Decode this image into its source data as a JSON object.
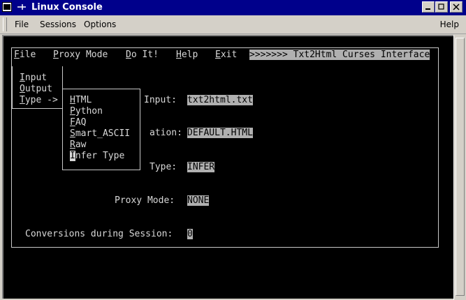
{
  "window": {
    "title": "Linux Console",
    "icons": {
      "app": "terminal-icon",
      "pin": "pin-icon",
      "minimize": "minimize-icon",
      "maximize": "maximize-icon",
      "close": "close-icon"
    }
  },
  "menubar": {
    "items": [
      "File",
      "Sessions",
      "Options"
    ],
    "help": "Help"
  },
  "app_menu": {
    "items": [
      {
        "hotkey": "F",
        "rest": "ile"
      },
      {
        "hotkey": "P",
        "rest": "roxy Mode"
      },
      {
        "hotkey": "D",
        "rest": "o It!"
      },
      {
        "hotkey": "H",
        "rest": "elp"
      },
      {
        "hotkey": "E",
        "rest": "xit"
      }
    ],
    "banner": ">>>>>>> Txt2Html Curses Interface"
  },
  "file_menu": {
    "items": [
      {
        "hotkey": "I",
        "rest": "nput"
      },
      {
        "hotkey": "O",
        "rest": "utput"
      },
      {
        "hotkey": "T",
        "rest": "ype ->"
      }
    ]
  },
  "type_submenu": {
    "items": [
      {
        "hotkey": "H",
        "rest": "TML"
      },
      {
        "hotkey": "P",
        "rest": "ython"
      },
      {
        "hotkey": "F",
        "rest": "AQ"
      },
      {
        "hotkey": "S",
        "rest": "mart_ASCII"
      },
      {
        "hotkey": "R",
        "rest": "aw"
      },
      {
        "hotkey": "I",
        "rest": "nfer Type"
      }
    ]
  },
  "fields": {
    "input_label": "Input:",
    "input_value": "txt2html.txt",
    "output_label": "ation:",
    "output_value": "DEFAULT.HTML",
    "type_label": "Type:",
    "type_value": "INFER",
    "proxy_label": "Proxy Mode:",
    "proxy_value": "NONE",
    "conv_label": "Conversions during Session:",
    "conv_value": "0"
  }
}
